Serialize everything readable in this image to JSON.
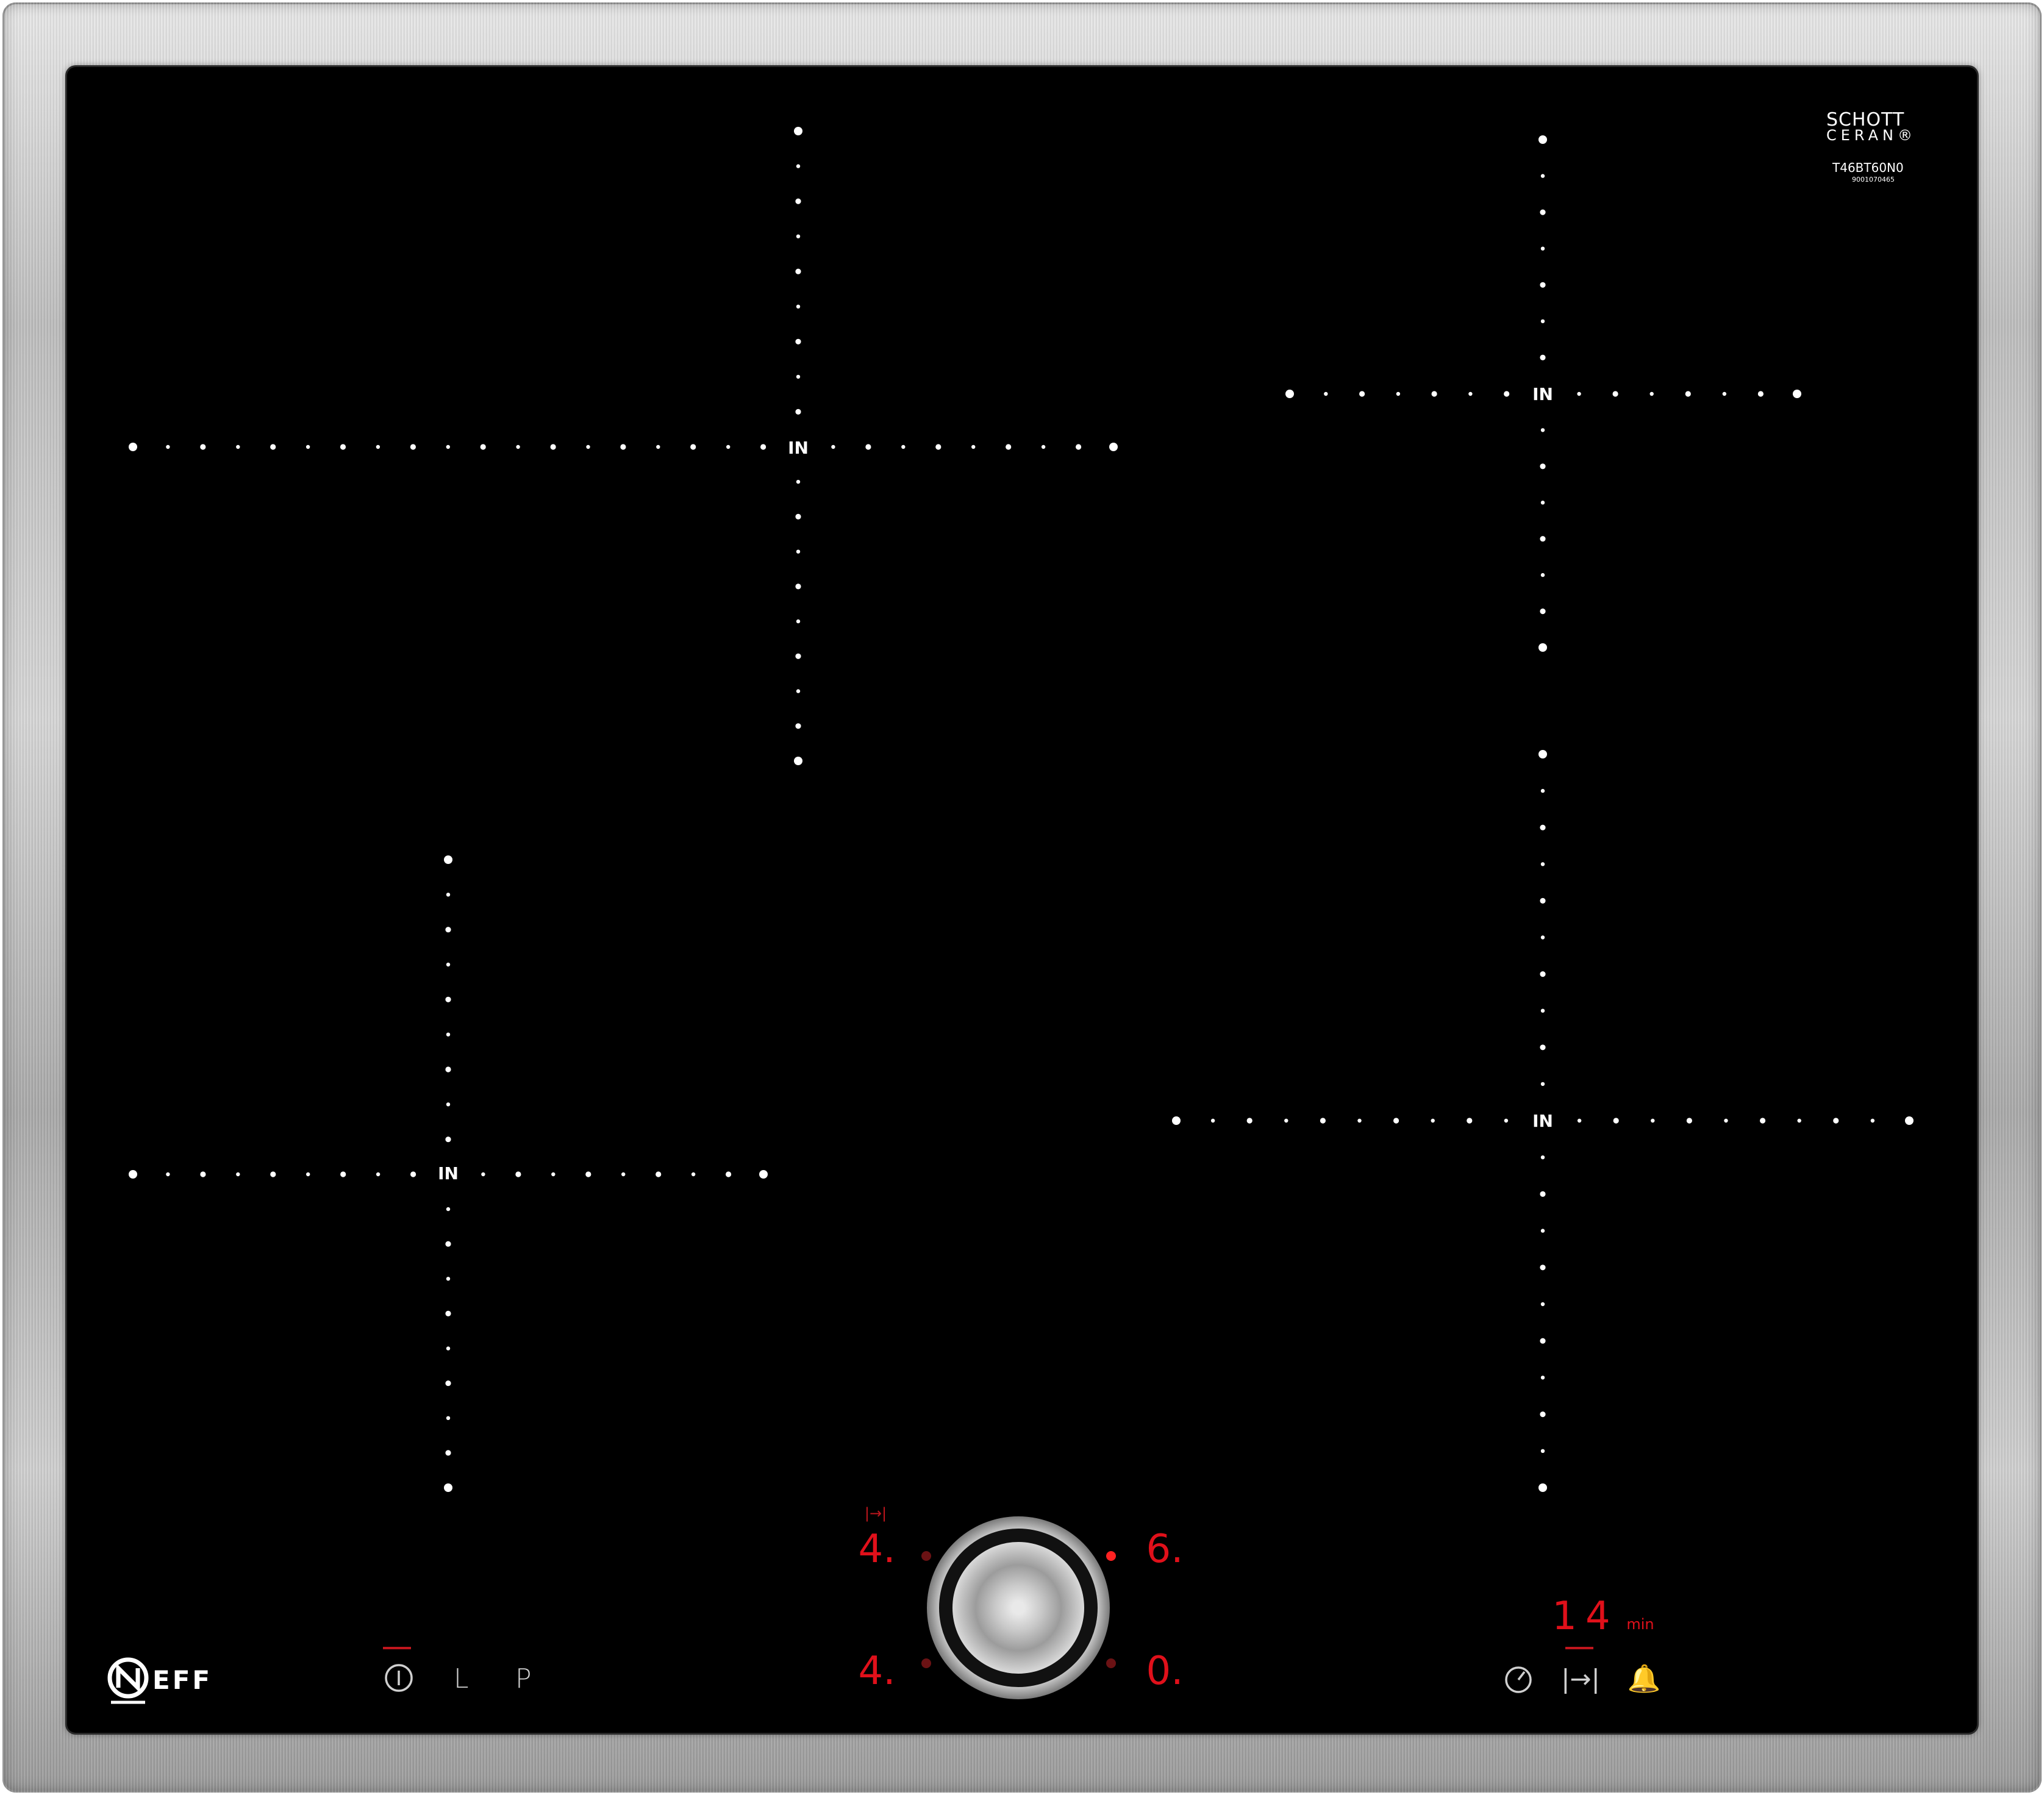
{
  "branding": {
    "brand": "EFF",
    "glass_brand_line1": "SCHOTT",
    "glass_brand_line2": "CERAN®",
    "model": "T46BT60N0",
    "serial": "9001070465"
  },
  "zones": [
    {
      "id": "front-left",
      "label": "IN"
    },
    {
      "id": "rear-left",
      "label": "IN"
    },
    {
      "id": "rear-right",
      "label": "IN"
    },
    {
      "id": "front-right",
      "label": "IN"
    }
  ],
  "controls_left": {
    "power": "power-icon",
    "lock": "L",
    "powerboost": "P"
  },
  "center_display": {
    "timer_glyph": "|→|",
    "rear_left": "4.",
    "rear_right": "6.",
    "front_left": "4.",
    "front_right": "0."
  },
  "timer": {
    "value": "14",
    "unit": "min"
  },
  "controls_right": {
    "cooking_timer": "stopwatch-icon",
    "zone_timer": "|→|",
    "alarm": "🔔"
  },
  "colors": {
    "glass": "#000000",
    "display_red": "#e0101a",
    "symbols": "#cfcfcf",
    "dots": "#ffffff"
  }
}
